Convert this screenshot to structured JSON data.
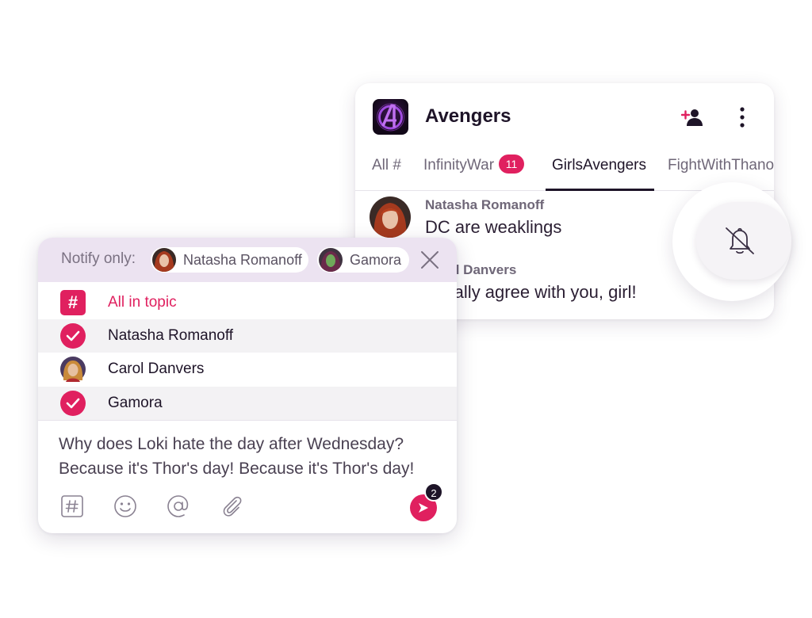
{
  "chat": {
    "title": "Avengers",
    "tabs": [
      {
        "label": "All #"
      },
      {
        "label": "InfinityWar",
        "badge": "11"
      },
      {
        "label": "GirlsAvengers",
        "active": true
      },
      {
        "label": "FightWithThanos"
      }
    ],
    "messages": [
      {
        "author": "Natasha Romanoff",
        "text": "DC are weaklings"
      },
      {
        "author": "Carol Danvers",
        "text": "I totally agree with you, girl!"
      }
    ],
    "icons": {
      "add_user": "add-user-icon",
      "more": "more-vertical-icon",
      "bell": "bell-off-icon"
    }
  },
  "compose": {
    "notify_label": "Notify only:",
    "chips": [
      {
        "name": "Natasha Romanoff"
      },
      {
        "name": "Gamora"
      }
    ],
    "options": [
      {
        "label": "All in topic",
        "icon": "hash-icon"
      },
      {
        "label": "Natasha Romanoff",
        "selected": true
      },
      {
        "label": "Carol Danvers",
        "selected": false
      },
      {
        "label": "Gamora",
        "selected": true
      }
    ],
    "message_lines": [
      "Why does Loki hate the day after Wednesday?",
      "Because it's Thor's day! Because it's Thor's day!"
    ],
    "send_count": "2"
  },
  "colors": {
    "accent": "#e0205f",
    "notify_bg": "#ece3f1",
    "dark": "#1e1428"
  }
}
